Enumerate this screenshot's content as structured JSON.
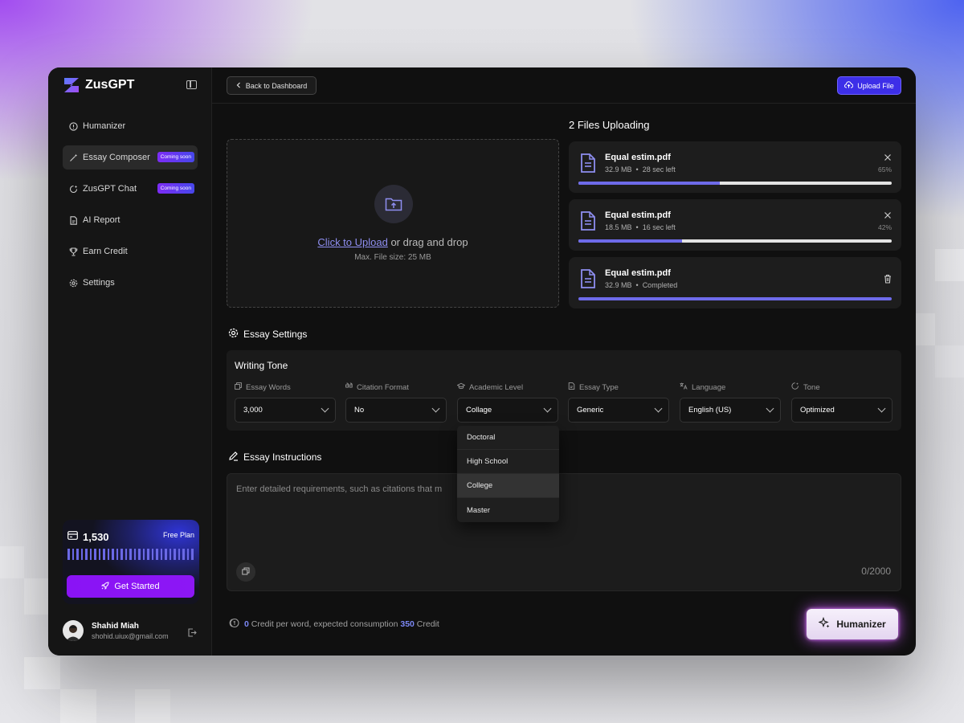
{
  "app": {
    "name": "ZusGPT"
  },
  "sidebar": {
    "items": [
      {
        "label": "Humanizer",
        "badge": ""
      },
      {
        "label": "Essay Composer",
        "badge": "Coming soon"
      },
      {
        "label": "ZusGPT Chat",
        "badge": "Coming soon"
      },
      {
        "label": "AI Report",
        "badge": ""
      },
      {
        "label": "Earn Credit",
        "badge": ""
      },
      {
        "label": "Settings",
        "badge": ""
      }
    ],
    "credits": "1,530",
    "plan": "Free Plan",
    "get_started": "Get Started",
    "user": {
      "name": "Shahid Miah",
      "email": "shohid.uiux@gmail.com"
    }
  },
  "topbar": {
    "back": "Back to Dashboard",
    "upload": "Upload File"
  },
  "upload": {
    "click_link": "Click to Upload",
    "drag_text": " or drag and drop",
    "max_size": "Max. File size: 25 MB"
  },
  "files": {
    "title": "2 Files Uploading",
    "items": [
      {
        "name": "Equal estim.pdf",
        "size": "32.9 MB",
        "status": "28 sec left",
        "percent": "65%",
        "progress": 0.45
      },
      {
        "name": "Equal estim.pdf",
        "size": "18.5 MB",
        "status": "16 sec left",
        "percent": "42%",
        "progress": 0.33
      },
      {
        "name": "Equal estim.pdf",
        "size": "32.9 MB",
        "status": "Completed",
        "percent": "",
        "progress": 1.0
      }
    ]
  },
  "essay_settings": {
    "title": "Essay Settings",
    "writing_tone": "Writing Tone",
    "fields": [
      {
        "label": "Essay Words",
        "value": "3,000",
        "icon": "copy-icon"
      },
      {
        "label": "Citation Format",
        "value": "No",
        "icon": "quote-icon"
      },
      {
        "label": "Academic Level",
        "value": "Collage",
        "icon": "graduation-cap-icon"
      },
      {
        "label": "Essay Type",
        "value": "Generic",
        "icon": "document-icon"
      },
      {
        "label": "Language",
        "value": "English (US)",
        "icon": "translate-icon"
      },
      {
        "label": "Tone",
        "value": "Optimized",
        "icon": "sparkle-icon"
      }
    ]
  },
  "dropdown": {
    "options": [
      "Doctoral",
      "High School",
      "College",
      "Master"
    ],
    "selected": "College"
  },
  "instructions": {
    "title": "Essay Instructions",
    "placeholder": "Enter detailed requirements, such as citations that m",
    "counter": "0/2000"
  },
  "footer": {
    "credit_zero": "0",
    "credit_text1": " Credit per word, expected consumption ",
    "credit_value": "350",
    "credit_text2": " Credit",
    "humanize_button": "Humanizer"
  },
  "colors": {
    "accent": "#6e6bea",
    "brand_purple": "#8a13f5",
    "upload_blue": "#3d2fe8"
  }
}
